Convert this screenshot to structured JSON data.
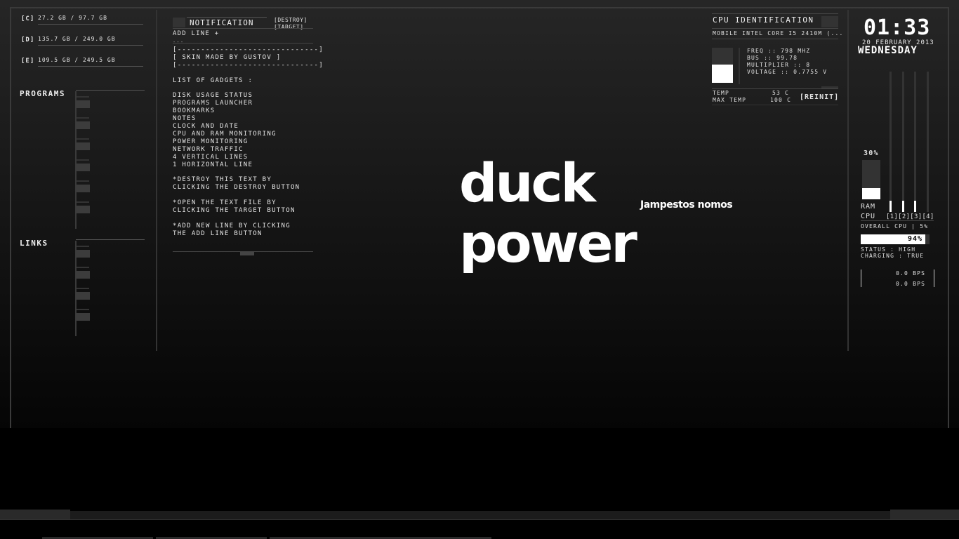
{
  "disks": [
    {
      "label": "[C]",
      "value": "27.2 GB / 97.7 GB"
    },
    {
      "label": "[D]",
      "value": "135.7 GB / 249.0 GB"
    },
    {
      "label": "[E]",
      "value": "109.5 GB / 249.5 GB"
    }
  ],
  "launcher": {
    "programs_title": "PROGRAMS",
    "links_title": "LINKS"
  },
  "notes": {
    "title": "NOTIFICATION",
    "destroy_label": "[DESTROY]",
    "target_label": "[TARGET]",
    "add_line_label": "ADD LINE +",
    "separator_short": "---",
    "body": "[------------------------------]\n[ SKIN MADE BY GUSTOV ]\n[------------------------------]\n\nLIST OF GADGETS :\n\nDISK USAGE STATUS\nPROGRAMS LAUNCHER\nBOOKMARKS\nNOTES\nCLOCK AND DATE\nCPU AND RAM MONITORING\nPOWER MONITORING\nNETWORK TRAFFIC\n4 VERTICAL LINES\n1 HORIZONTAL LINE\n\n*DESTROY THIS TEXT BY\nCLICKING THE DESTROY BUTTON\n\n*OPEN THE TEXT FILE BY\nCLICKING THE TARGET BUTTON\n\n*ADD NEW LINE BY CLICKING\nTHE ADD LINE BUTTON"
  },
  "logo": {
    "title": "duck power",
    "subtitle": "Jampestos nomos"
  },
  "cpu_info": {
    "title": "CPU IDENTIFICATION",
    "model": "MOBILE INTEL CORE I5 2410M (...",
    "freq": "FREQ :: 798 MHZ",
    "bus": "BUS :: 99.78",
    "multiplier": "MULTIPLIER :: 8",
    "voltage": "VOLTAGE :: 0.7755 V",
    "temp_label": "TEMP",
    "temp_value": "53 C",
    "max_temp_label": "MAX TEMP",
    "max_temp_value": "100 C",
    "reinit_label": "[REINIT]"
  },
  "clock": {
    "time": "01:33",
    "date": "20 FEBRUARY 2013",
    "weekday": "WEDNESDAY"
  },
  "monitor": {
    "ram_percent_label": "30%",
    "ram_fraction": 0.3,
    "ram_label": "RAM",
    "cpu_label": "CPU",
    "core_labels": "[1][2][3][4]",
    "core_fractions": [
      0.08,
      0.08,
      0.08,
      0.0
    ],
    "overall_cpu": "OVERALL CPU | 5%",
    "battery_label": "94%",
    "battery_fraction": 0.94,
    "status": "STATUS : HIGH",
    "charging": "CHARGING : TRUE",
    "net_down": "0.0 BPS",
    "net_up": "0.0 BPS"
  }
}
